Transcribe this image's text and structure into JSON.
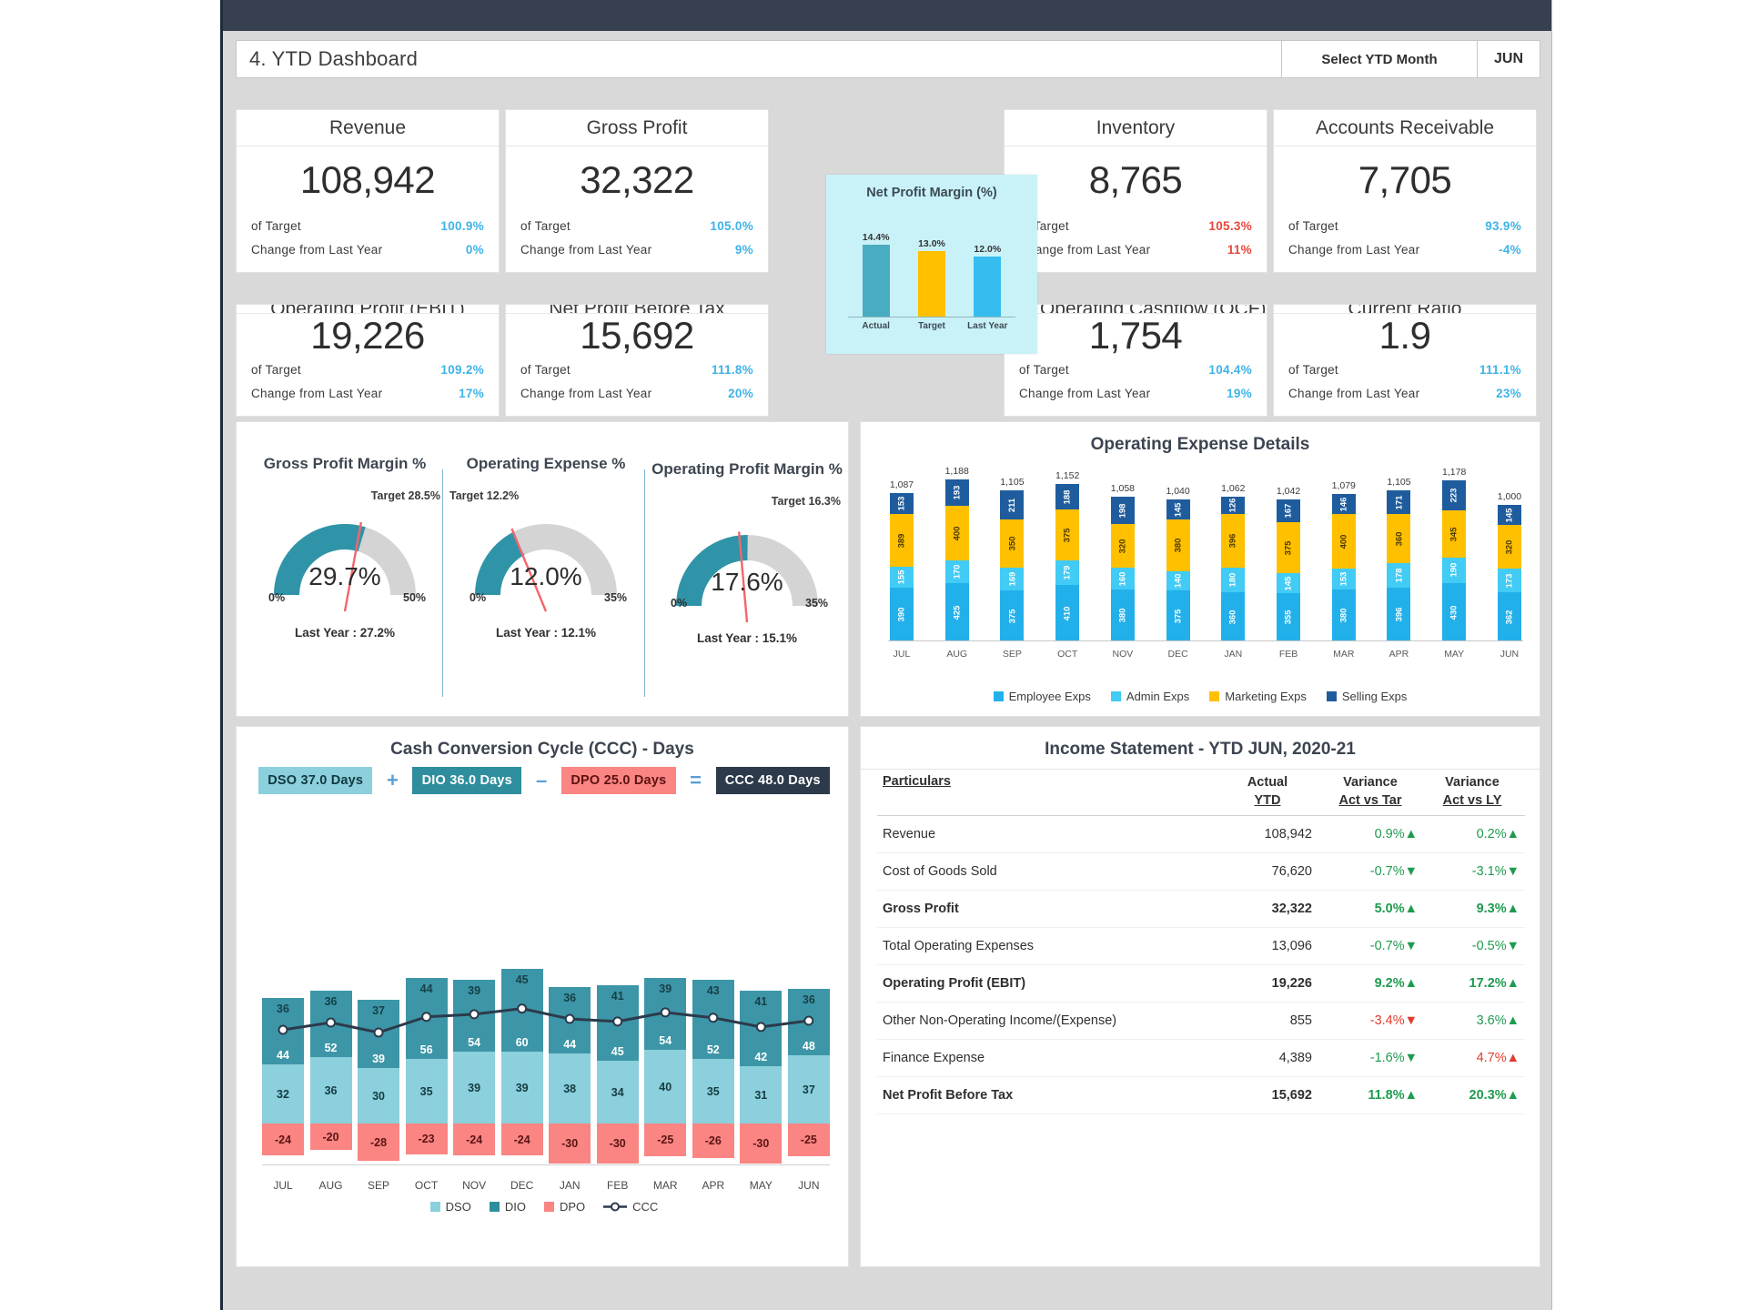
{
  "header": {
    "title": "4. YTD Dashboard",
    "select_label": "Select YTD Month",
    "month": "JUN"
  },
  "kpis": [
    {
      "name": "revenue",
      "title": "Revenue",
      "value": "108,942",
      "target_label": "of Target",
      "target_value": "100.9%",
      "target_color": "blue",
      "change_label": "Change from Last Year",
      "change_value": "0%",
      "change_color": "blue"
    },
    {
      "name": "gross-profit",
      "title": "Gross Profit",
      "value": "32,322",
      "target_label": "of Target",
      "target_value": "105.0%",
      "target_color": "blue",
      "change_label": "Change from Last Year",
      "change_value": "9%",
      "change_color": "blue"
    },
    {
      "name": "inventory",
      "title": "Inventory",
      "value": "8,765",
      "target_label": "of Target",
      "target_value": "105.3%",
      "target_color": "red",
      "change_label": "Change from Last Year",
      "change_value": "11%",
      "change_color": "red"
    },
    {
      "name": "accounts-receivable",
      "title": "Accounts Receivable",
      "value": "7,705",
      "target_label": "of Target",
      "target_value": "93.9%",
      "target_color": "blue",
      "change_label": "Change from Last Year",
      "change_value": "-4%",
      "change_color": "blue"
    },
    {
      "name": "operating-profit-ebit",
      "title": "Operating Profit (EBIT)",
      "value": "19,226",
      "target_label": "of Target",
      "target_value": "109.2%",
      "target_color": "blue",
      "change_label": "Change from Last Year",
      "change_value": "17%",
      "change_color": "blue"
    },
    {
      "name": "net-profit-before-tax",
      "title": "Net Profit Before Tax",
      "value": "15,692",
      "target_label": "of Target",
      "target_value": "111.8%",
      "target_color": "blue",
      "change_label": "Change from Last Year",
      "change_value": "20%",
      "change_color": "blue"
    },
    {
      "name": "net-operating-cashflow",
      "title": "Net Operating Cashflow (OCF)",
      "value": "1,754",
      "target_label": "of Target",
      "target_value": "104.4%",
      "target_color": "blue",
      "change_label": "Change from Last Year",
      "change_value": "19%",
      "change_color": "blue"
    },
    {
      "name": "current-ratio",
      "title": "Current Ratio",
      "value": "1.9",
      "target_label": "of Target",
      "target_value": "111.1%",
      "target_color": "blue",
      "change_label": "Change from Last Year",
      "change_value": "23%",
      "change_color": "blue"
    }
  ],
  "popup": {
    "chart_data": {
      "type": "bar",
      "title": "Net Profit Margin (%)",
      "categories": [
        "Actual",
        "Target",
        "Last Year"
      ],
      "values": [
        14.4,
        13.0,
        12.0
      ],
      "labels": [
        "14.4%",
        "13.0%",
        "12.0%"
      ],
      "colors": [
        "#4aacc0",
        "#ffc000",
        "#35bdf0"
      ],
      "ylim": [
        0,
        16
      ]
    }
  },
  "gauges": [
    {
      "name": "gross-profit-margin",
      "title": "Gross Profit Margin %",
      "target_label": "Target 28.5%",
      "value_label": "29.7%",
      "min_label": "0%",
      "max_label": "50%",
      "last_year": "Last Year : 27.2%",
      "value": 29.7,
      "target": 28.5,
      "max": 50
    },
    {
      "name": "operating-expense",
      "title": "Operating Expense %",
      "target_label": "Target 12.2%",
      "value_label": "12.0%",
      "min_label": "0%",
      "max_label": "35%",
      "last_year": "Last Year : 12.1%",
      "value": 12.0,
      "target": 12.2,
      "max": 35
    },
    {
      "name": "operating-profit-margin",
      "title": "Operating Profit Margin %",
      "target_label": "Target 16.3%",
      "value_label": "17.6%",
      "min_label": "0%",
      "max_label": "35%",
      "last_year": "Last Year : 15.1%",
      "value": 17.6,
      "target": 16.3,
      "max": 35
    }
  ],
  "opex": {
    "title": "Operating Expense Details",
    "chart_data": {
      "type": "bar",
      "title": "Operating Expense Details",
      "stacked": true,
      "categories": [
        "JUL",
        "AUG",
        "SEP",
        "OCT",
        "NOV",
        "DEC",
        "JAN",
        "FEB",
        "MAR",
        "APR",
        "MAY",
        "JUN"
      ],
      "series": [
        {
          "name": "Employee Exps",
          "color": "#22b0ea",
          "values": [
            390,
            425,
            375,
            410,
            380,
            375,
            360,
            355,
            380,
            396,
            430,
            362
          ]
        },
        {
          "name": "Admin Exps",
          "color": "#41cbf5",
          "values": [
            155,
            170,
            169,
            179,
            160,
            140,
            180,
            145,
            153,
            178,
            190,
            173
          ]
        },
        {
          "name": "Marketing Exps",
          "color": "#ffc000",
          "values": [
            389,
            400,
            350,
            375,
            320,
            380,
            396,
            375,
            400,
            360,
            345,
            320
          ]
        },
        {
          "name": "Selling Exps",
          "color": "#1f5c9e",
          "values": [
            153,
            193,
            211,
            188,
            198,
            145,
            126,
            167,
            146,
            171,
            223,
            145
          ]
        }
      ],
      "totals": [
        "1,087",
        "1,188",
        "1,105",
        "1,152",
        "1,058",
        "1,040",
        "1,062",
        "1,042",
        "1,079",
        "1,105",
        "1,178",
        "1,000"
      ],
      "total_values": [
        1087,
        1188,
        1105,
        1152,
        1058,
        1040,
        1062,
        1042,
        1079,
        1105,
        1178,
        1000
      ]
    }
  },
  "ccc": {
    "title": "Cash Conversion Cycle (CCC) - Days",
    "badges": [
      {
        "name": "dso-badge",
        "label": "DSO 37.0 Days",
        "bg": "#8bd0dc",
        "fg": "#123840"
      },
      {
        "name": "plus-operator",
        "label": "+",
        "bg": "",
        "fg": "#5a9fd4"
      },
      {
        "name": "dio-badge",
        "label": "DIO 36.0 Days",
        "bg": "#2f8e9e",
        "fg": "#ffffff"
      },
      {
        "name": "minus-operator",
        "label": "–",
        "bg": "",
        "fg": "#5a9fd4"
      },
      {
        "name": "dpo-badge",
        "label": "DPO 25.0 Days",
        "bg": "#fa8583",
        "fg": "#5e1212"
      },
      {
        "name": "equals-operator",
        "label": "=",
        "bg": "",
        "fg": "#5a9fd4"
      },
      {
        "name": "ccc-badge",
        "label": "CCC 48.0 Days",
        "bg": "#2c3a4b",
        "fg": "#ffffff"
      }
    ],
    "chart_data": {
      "type": "bar",
      "title": "Cash Conversion Cycle (CCC) - Days",
      "categories": [
        "JUL",
        "AUG",
        "SEP",
        "OCT",
        "NOV",
        "DEC",
        "JAN",
        "FEB",
        "MAR",
        "APR",
        "MAY",
        "JUN"
      ],
      "series": [
        {
          "name": "DSO",
          "color": "#8bd0dc",
          "values": [
            32,
            36,
            30,
            35,
            39,
            39,
            38,
            34,
            40,
            35,
            31,
            37
          ]
        },
        {
          "name": "DIO",
          "color": "#2f8e9e",
          "values": [
            36,
            36,
            37,
            44,
            39,
            45,
            36,
            41,
            39,
            43,
            41,
            36
          ]
        },
        {
          "name": "DPO",
          "color": "#fa8583",
          "values": [
            -24,
            -20,
            -28,
            -23,
            -24,
            -24,
            -30,
            -30,
            -25,
            -26,
            -30,
            -25
          ]
        },
        {
          "name": "CCC",
          "color": "#2c3a4b",
          "values": [
            44,
            52,
            39,
            56,
            54,
            60,
            44,
            45,
            54,
            52,
            42,
            48
          ]
        }
      ],
      "legend": [
        "DSO",
        "DIO",
        "DPO",
        "CCC"
      ]
    }
  },
  "income_statement": {
    "title": "Income Statement - YTD JUN, 2020-21",
    "columns": {
      "particulars": "Particulars",
      "actual_line1": "Actual",
      "actual_line2": "YTD",
      "var_target_line1": "Variance",
      "var_target_line2": "Act vs Tar",
      "var_ly_line1": "Variance",
      "var_ly_line2": "Act vs LY"
    },
    "rows": [
      {
        "label": "Revenue",
        "actual": "108,942",
        "var_target": "0.9%",
        "vt_dir": "up",
        "var_ly": "0.2%",
        "vl_dir": "up",
        "bold": false
      },
      {
        "label": "Cost of Goods Sold",
        "actual": "76,620",
        "var_target": "-0.7%",
        "vt_dir": "down",
        "var_ly": "-3.1%",
        "vl_dir": "down",
        "bold": false
      },
      {
        "label": "Gross Profit",
        "actual": "32,322",
        "var_target": "5.0%",
        "vt_dir": "up",
        "var_ly": "9.3%",
        "vl_dir": "up",
        "bold": true
      },
      {
        "label": "Total Operating Expenses",
        "actual": "13,096",
        "var_target": "-0.7%",
        "vt_dir": "down",
        "var_ly": "-0.5%",
        "vl_dir": "down",
        "bold": false
      },
      {
        "label": "Operating Profit (EBIT)",
        "actual": "19,226",
        "var_target": "9.2%",
        "vt_dir": "up",
        "var_ly": "17.2%",
        "vl_dir": "up",
        "bold": true
      },
      {
        "label": "Other Non-Operating Income/(Expense)",
        "actual": "855",
        "var_target": "-3.4%",
        "vt_dir": "down-red",
        "var_ly": "3.6%",
        "vl_dir": "up",
        "bold": false
      },
      {
        "label": "Finance Expense",
        "actual": "4,389",
        "var_target": "-1.6%",
        "vt_dir": "down",
        "var_ly": "4.7%",
        "vl_dir": "up-red",
        "bold": false
      },
      {
        "label": "Net Profit Before Tax",
        "actual": "15,692",
        "var_target": "11.8%",
        "vt_dir": "up",
        "var_ly": "20.3%",
        "vl_dir": "up",
        "bold": true
      }
    ]
  }
}
